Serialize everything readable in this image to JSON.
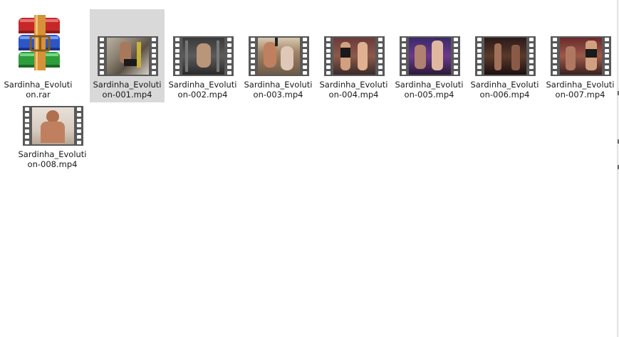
{
  "files": [
    {
      "name_line1": "Sardinha_Evoluti",
      "name_line2": "on.rar",
      "type": "archive-rar",
      "icon": "winrar-books-icon"
    },
    {
      "name_line1": "Sardinha_Evoluti",
      "name_line2": "on-001.mp4",
      "type": "video",
      "icon": "video-thumbnail-icon",
      "selected": true
    },
    {
      "name_line1": "Sardinha_Evoluti",
      "name_line2": "on-002.mp4",
      "type": "video",
      "icon": "video-thumbnail-icon"
    },
    {
      "name_line1": "Sardinha_Evoluti",
      "name_line2": "on-003.mp4",
      "type": "video",
      "icon": "video-thumbnail-icon"
    },
    {
      "name_line1": "Sardinha_Evoluti",
      "name_line2": "on-004.mp4",
      "type": "video",
      "icon": "video-thumbnail-icon"
    },
    {
      "name_line1": "Sardinha_Evoluti",
      "name_line2": "on-005.mp4",
      "type": "video",
      "icon": "video-thumbnail-icon"
    },
    {
      "name_line1": "Sardinha_Evoluti",
      "name_line2": "on-006.mp4",
      "type": "video",
      "icon": "video-thumbnail-icon"
    },
    {
      "name_line1": "Sardinha_Evoluti",
      "name_line2": "on-007.mp4",
      "type": "video",
      "icon": "video-thumbnail-icon"
    },
    {
      "name_line1": "Sardinha_Evoluti",
      "name_line2": "on-008.mp4",
      "type": "video",
      "icon": "video-thumbnail-icon"
    }
  ],
  "colors": {
    "selection": "#d9d9d9",
    "film_strip": "#595959",
    "rar_red": "#d32f2f",
    "rar_blue": "#2f5fd3",
    "rar_green": "#2e9e3c",
    "rar_belt": "#d99a3a"
  }
}
